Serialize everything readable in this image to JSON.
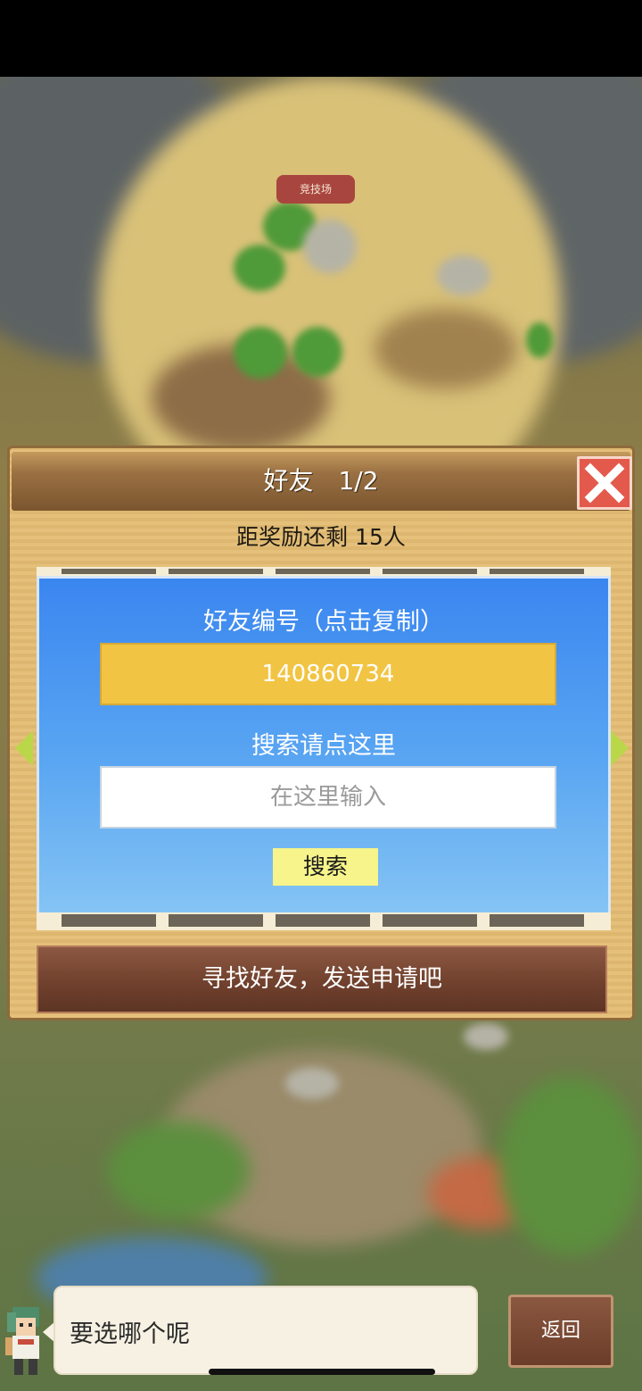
{
  "map": {
    "arena_label": "竞技场"
  },
  "dialog": {
    "title": "好友　1/2",
    "reward_text": "距奖励还剩 15人",
    "panel": {
      "friend_id_label": "好友编号（点击复制）",
      "friend_id_value": "140860734",
      "search_label": "搜索请点这里",
      "search_placeholder": "在这里输入",
      "search_button": "搜索"
    },
    "find_button": "寻找好友，发送申请吧"
  },
  "bottom": {
    "speech_text": "要选哪个呢",
    "back_button": "返回"
  },
  "colors": {
    "panel_blue": "#3a86f0",
    "id_box_yellow": "#f2c443",
    "search_button": "#f6f48a",
    "close_red": "#e35a4c",
    "header_brown": "#7a552f",
    "nav_arrow": "#b9d748"
  }
}
